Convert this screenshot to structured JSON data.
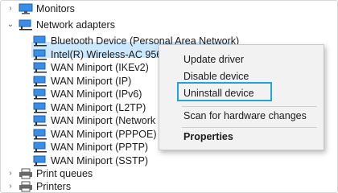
{
  "tree": {
    "monitors": "Monitors",
    "network_adapters": "Network adapters",
    "adapters": [
      "Bluetooth Device (Personal Area Network)",
      "Intel(R) Wireless-AC 9560 160MHz",
      "WAN Miniport (IKEv2)",
      "WAN Miniport (IP)",
      "WAN Miniport (IPv6)",
      "WAN Miniport (L2TP)",
      "WAN Miniport (Network Monitor)",
      "WAN Miniport (PPPOE)",
      "WAN Miniport (PPTP)",
      "WAN Miniport (SSTP)"
    ],
    "print_queues": "Print queues",
    "printers": "Printers"
  },
  "context_menu": {
    "update_driver": "Update driver",
    "disable_device": "Disable device",
    "uninstall_device": "Uninstall device",
    "scan_hardware": "Scan for hardware changes",
    "properties": "Properties"
  },
  "colors": {
    "selection": "#cce8ff",
    "highlight_outline": "#1da7d8",
    "menu_background": "#f2f2f2",
    "network_icon": "#2f7fd6"
  },
  "icons": {
    "expand": "chevron-right-icon",
    "collapse": "chevron-down-icon",
    "monitor": "monitor-icon",
    "network": "network-adapter-icon",
    "printer": "printer-icon"
  }
}
